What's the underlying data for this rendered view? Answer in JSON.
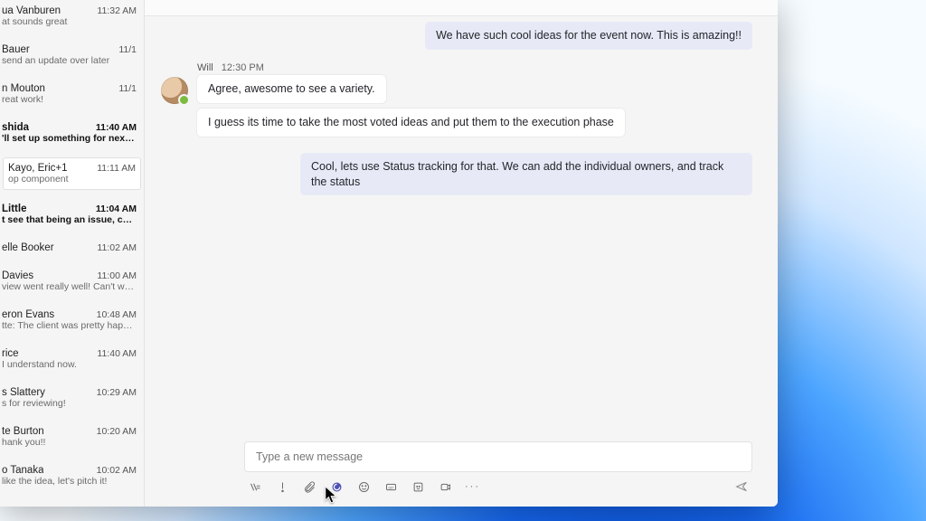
{
  "sidebar": {
    "items": [
      {
        "name": "ua Vanburen",
        "time": "11:32 AM",
        "preview": "at sounds great",
        "unread": false
      },
      {
        "name": "Bauer",
        "time": "11/1",
        "preview": "send an update over later",
        "unread": false
      },
      {
        "name": "n Mouton",
        "time": "11/1",
        "preview": "reat work!",
        "unread": false
      },
      {
        "name": "shida",
        "time": "11:40 AM",
        "preview": "'ll set up something for next week to...",
        "unread": true
      },
      {
        "name": "Kayo, Eric+1",
        "time": "11:11 AM",
        "preview": "op component",
        "unread": false,
        "selected": true
      },
      {
        "name": "Little",
        "time": "11:04 AM",
        "preview": "t see that being an issue, can take t...",
        "unread": true
      },
      {
        "name": "elle Booker",
        "time": "11:02 AM",
        "preview": "",
        "unread": false
      },
      {
        "name": "Davies",
        "time": "11:00 AM",
        "preview": "view went really well! Can't wait to...",
        "unread": false
      },
      {
        "name": "eron Evans",
        "time": "10:48 AM",
        "preview": "tte: The client was pretty happy with...",
        "unread": false
      },
      {
        "name": "rice",
        "time": "11:40 AM",
        "preview": "I understand now.",
        "unread": false
      },
      {
        "name": "s Slattery",
        "time": "10:29 AM",
        "preview": "s for reviewing!",
        "unread": false
      },
      {
        "name": "te Burton",
        "time": "10:20 AM",
        "preview": "hank you!!",
        "unread": false
      },
      {
        "name": "o Tanaka",
        "time": "10:02 AM",
        "preview": "like the idea, let's pitch it!",
        "unread": false
      }
    ]
  },
  "chat": {
    "out1": "We have such cool ideas for the event now. This is amazing!!",
    "sender": "Will",
    "time": "12:30 PM",
    "in1": "Agree, awesome to see a variety.",
    "in2": "I guess its time to take the most voted ideas and put them to the execution phase",
    "out2": "Cool, lets use Status tracking for that. We can add the individual owners, and track the status"
  },
  "compose": {
    "placeholder": "Type a new message",
    "more": "···"
  }
}
